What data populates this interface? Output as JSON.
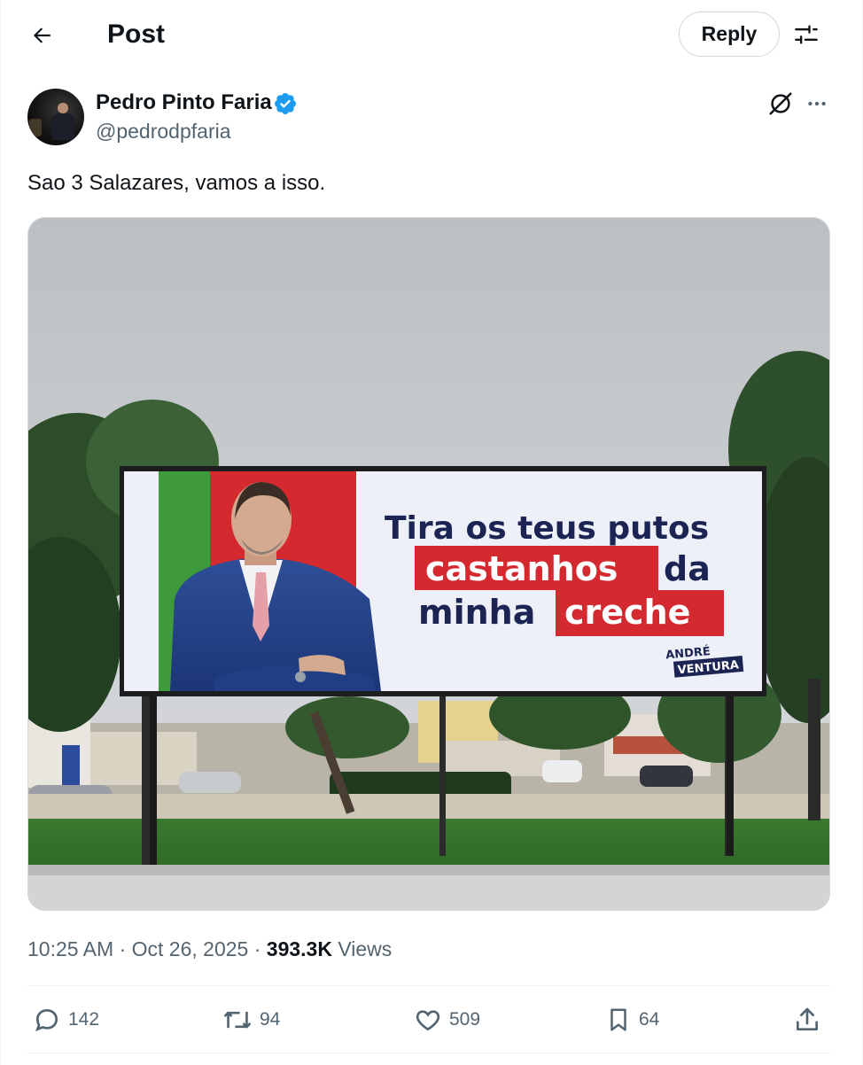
{
  "header": {
    "title": "Post",
    "reply_label": "Reply"
  },
  "author": {
    "name": "Pedro Pinto Faria",
    "handle": "@pedrodpfaria",
    "verified": true
  },
  "post": {
    "text": "Sao 3 Salazares, vamos a isso."
  },
  "billboard": {
    "line1": "Tira os teus putos",
    "line2_highlight": "castanhos",
    "line2_rest": "da",
    "line3_plain": "minha",
    "line3_highlight": "creche",
    "logo_top": "ANDRÉ",
    "logo_bottom": "VENTURA",
    "colors": {
      "green": "#3f9a3c",
      "red": "#d42a2f",
      "navy": "#1b2453",
      "panel": "#eef0f8"
    }
  },
  "meta": {
    "time": "10:25 AM",
    "separator": "·",
    "date": "Oct 26, 2025",
    "views_count": "393.3K",
    "views_label": "Views"
  },
  "actions": {
    "replies": "142",
    "reposts": "94",
    "likes": "509",
    "bookmarks": "64"
  },
  "icons": [
    "back-arrow-icon",
    "settings-sliders-icon",
    "verified-badge-icon",
    "grok-icon",
    "more-dots-icon",
    "reply-icon",
    "repost-icon",
    "like-icon",
    "bookmark-icon",
    "share-icon"
  ],
  "colors": {
    "accent": "#1d9bf0",
    "text": "#0f1419",
    "secondary": "#536471",
    "border": "#cfd9de"
  }
}
